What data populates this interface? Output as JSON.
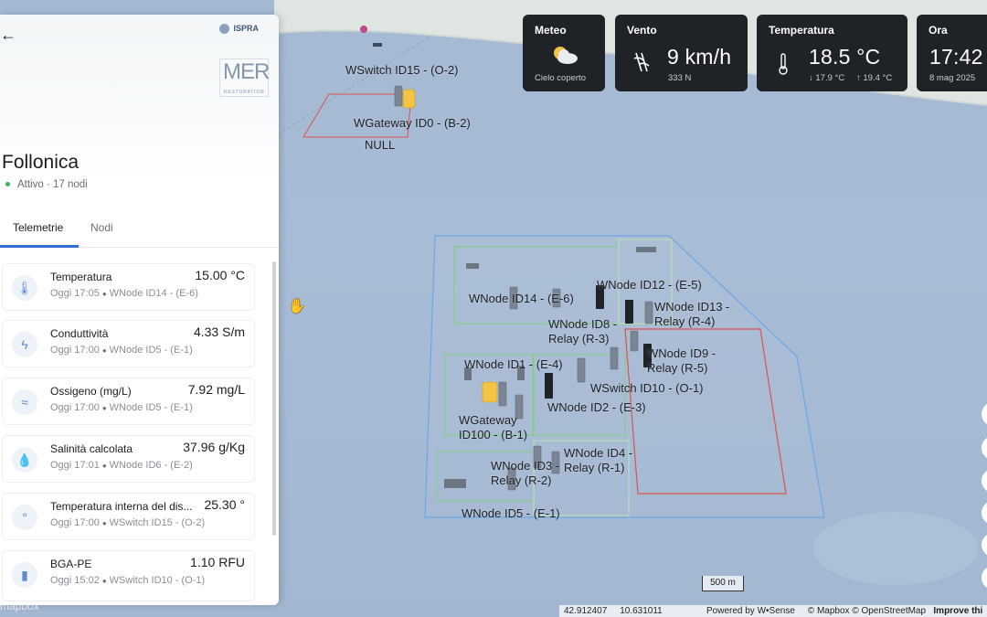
{
  "widgets": {
    "meteo": {
      "title": "Meteo",
      "condition": "Cielo coperto",
      "icon": "cloud-sun-icon"
    },
    "vento": {
      "title": "Vento",
      "speed": "9 km/h",
      "direction": "333 N",
      "icon": "wind-icon"
    },
    "temperatura": {
      "title": "Temperatura",
      "value": "18.5 °C",
      "min": "↓ 17.9 °C",
      "max": "↑ 19.4 °C",
      "icon": "thermometer-icon"
    },
    "ora": {
      "title": "Ora",
      "time": "17:42",
      "date": "8 mag 2025"
    }
  },
  "panel": {
    "title": "Follonica",
    "status": "Attivo · 17 nodi",
    "logos": {
      "ispra": "ISPRA",
      "mer": "MER",
      "mer_sub": "RESTORATION"
    },
    "tabs": [
      {
        "label": "Telemetrie",
        "active": true
      },
      {
        "label": "Nodi",
        "active": false
      }
    ],
    "telemetries": [
      {
        "name": "Temperatura",
        "value": "15.00 °C",
        "time": "Oggi 17:05",
        "node": "WNode ID14 - (E-6)",
        "icon": "thermometer-icon"
      },
      {
        "name": "Conduttività",
        "value": "4.33 S/m",
        "time": "Oggi 17:00",
        "node": "WNode ID5 - (E-1)",
        "icon": "lightning-icon"
      },
      {
        "name": "Ossigeno (mg/L)",
        "value": "7.92 mg/L",
        "time": "Oggi 17:00",
        "node": "WNode ID5 - (E-1)",
        "icon": "waves-icon"
      },
      {
        "name": "Salinità calcolata",
        "value": "37.96 g/Kg",
        "time": "Oggi 17:01",
        "node": "WNode ID6 - (E-2)",
        "icon": "droplet-icon"
      },
      {
        "name": "Temperatura interna del dis...",
        "value": "25.30 °",
        "time": "Oggi 17:00",
        "node": "WSwitch ID15 - (O-2)",
        "icon": "internal-temp-icon"
      },
      {
        "name": "BGA-PE",
        "value": "1.10 RFU",
        "time": "Oggi 15:02",
        "node": "WSwitch ID10 - (O-1)",
        "icon": "bar-chart-icon"
      }
    ]
  },
  "map": {
    "labels": {
      "wswitch15": "WSwitch ID15 - (O-2)",
      "wgateway0": "WGateway ID0 - (B-2)",
      "null": "NULL",
      "wnode14": "WNode ID14 - (E-6)",
      "wnode12": "WNode ID12 - (E-5)",
      "wnode13": "WNode ID13 - Relay (R-4)",
      "wnode8": "WNode ID8 - Relay (R-3)",
      "wnode9": "WNode ID9 - Relay (R-5)",
      "wnode1": "WNode ID1 - (E-4)",
      "wswitch10": "WSwitch ID10 - (O-1)",
      "wnode2": "WNode ID2 - (E-3)",
      "wgateway100": "WGateway ID100 - (B-1)",
      "wnode4": "WNode ID4 - Relay (R-1)",
      "wnode3": "WNode ID3 - Relay (R-2)",
      "wnode5": "WNode ID5 - (E-1)"
    },
    "scale": "500 m",
    "coords": {
      "lat": "42.912407",
      "lon": "10.631011"
    },
    "attribution": {
      "powered": "Powered by W•Sense",
      "mapbox": "© Mapbox",
      "osm": "© OpenStreetMap",
      "improve": "Improve thi"
    },
    "mapbox_logo": "mapbox"
  },
  "colors": {
    "widget_bg": "#1f2227",
    "accent": "#2f6fd6",
    "status_green": "#3bb36b",
    "zone_blue": "#6aa8e8",
    "zone_green": "#7fcf7f",
    "zone_red": "#d9534f"
  }
}
